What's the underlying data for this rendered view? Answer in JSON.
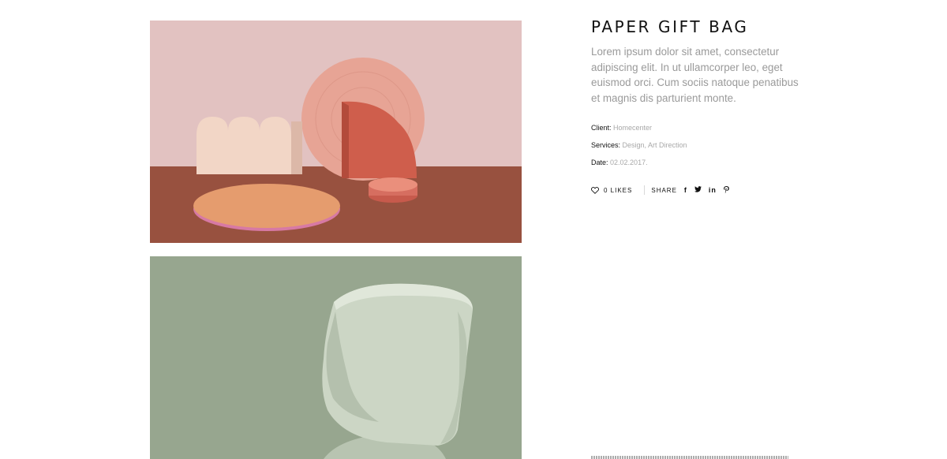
{
  "project": {
    "title": "PAPER GIFT BAG",
    "description": "Lorem ipsum dolor sit amet, consectetur adipiscing elit. In ut ullamcorper leo, eget euismod orci. Cum sociis natoque penatibus et magnis dis parturient monte.",
    "meta": [
      {
        "key": "Client:",
        "value": "Homecenter"
      },
      {
        "key": "Services:",
        "value": "Design, Art Direction"
      },
      {
        "key": "Date:",
        "value": "02.02.2017."
      }
    ]
  },
  "social": {
    "likes_label": "0 LIKES",
    "share_label": "SHARE",
    "icons": [
      "facebook-icon",
      "twitter-icon",
      "linkedin-icon",
      "pinterest-icon"
    ]
  },
  "colors": {
    "photo1_wall": "#e4c3c0",
    "photo1_floor": "#9a5545",
    "photo2_bg": "#97a88f",
    "chair": "#c9d3c2"
  }
}
